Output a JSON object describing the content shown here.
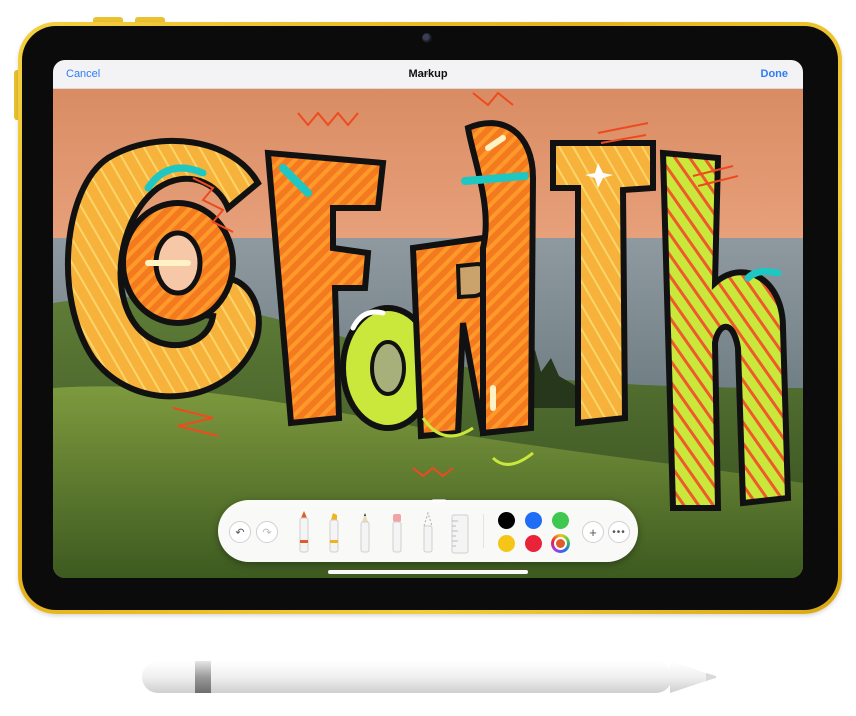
{
  "navbar": {
    "cancel_label": "Cancel",
    "title": "Markup",
    "done_label": "Done"
  },
  "artwork": {
    "subject": "GO FORTH hand-lettered drawing over landscape photo",
    "letters": [
      "G",
      "O",
      "F",
      "O",
      "R",
      "T",
      "h"
    ]
  },
  "palette": {
    "history": [
      "undo-icon",
      "redo-icon"
    ],
    "tools": [
      "pen",
      "marker",
      "pencil",
      "eraser",
      "lasso",
      "ruler"
    ],
    "colors": [
      "#000000",
      "#1f6cf5",
      "#3ec84f",
      "#f5c518",
      "#e8233a",
      "multicolor"
    ],
    "selected_color": "multicolor",
    "add_icon": "plus-icon",
    "more_icon": "ellipsis-icon"
  },
  "accent": {
    "blue": "#2d7cf6",
    "ipad_body": "#ecc02b"
  }
}
